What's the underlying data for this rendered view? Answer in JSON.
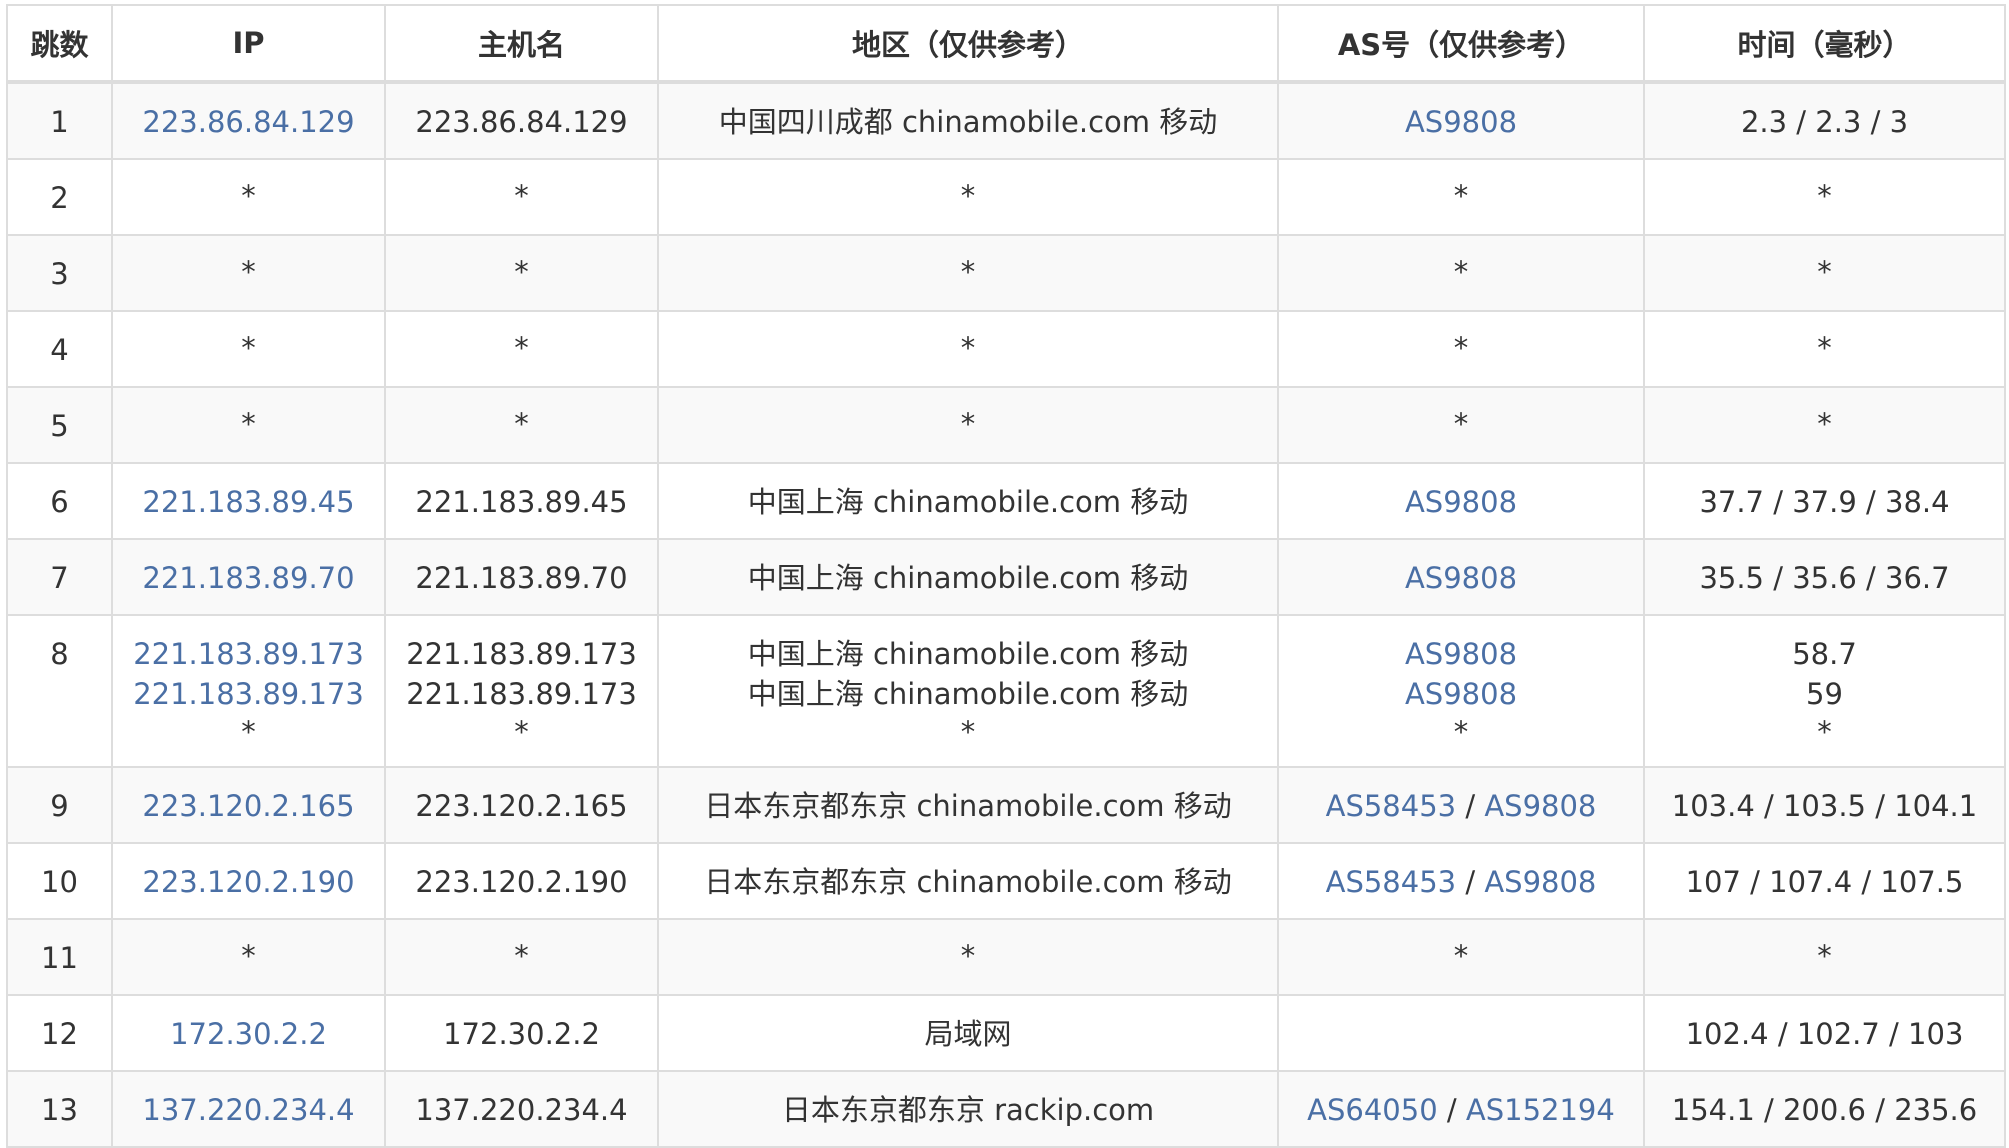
{
  "headers": {
    "hop": "跳数",
    "ip": "IP",
    "host": "主机名",
    "region": "地区（仅供参考）",
    "as": "AS号（仅供参考）",
    "time": "时间（毫秒）"
  },
  "sep": "/",
  "rows": [
    {
      "hop": "1",
      "ip": [
        "223.86.84.129"
      ],
      "host": [
        "223.86.84.129"
      ],
      "region": [
        "中国四川成都 chinamobile.com 移动"
      ],
      "as": [
        [
          "AS9808"
        ]
      ],
      "time": [
        "2.3 / 2.3 / 3"
      ]
    },
    {
      "hop": "2",
      "ip": [
        "*"
      ],
      "host": [
        "*"
      ],
      "region": [
        "*"
      ],
      "as": [
        [
          "*"
        ]
      ],
      "time": [
        "*"
      ]
    },
    {
      "hop": "3",
      "ip": [
        "*"
      ],
      "host": [
        "*"
      ],
      "region": [
        "*"
      ],
      "as": [
        [
          "*"
        ]
      ],
      "time": [
        "*"
      ]
    },
    {
      "hop": "4",
      "ip": [
        "*"
      ],
      "host": [
        "*"
      ],
      "region": [
        "*"
      ],
      "as": [
        [
          "*"
        ]
      ],
      "time": [
        "*"
      ]
    },
    {
      "hop": "5",
      "ip": [
        "*"
      ],
      "host": [
        "*"
      ],
      "region": [
        "*"
      ],
      "as": [
        [
          "*"
        ]
      ],
      "time": [
        "*"
      ]
    },
    {
      "hop": "6",
      "ip": [
        "221.183.89.45"
      ],
      "host": [
        "221.183.89.45"
      ],
      "region": [
        "中国上海 chinamobile.com 移动"
      ],
      "as": [
        [
          "AS9808"
        ]
      ],
      "time": [
        "37.7 / 37.9 / 38.4"
      ]
    },
    {
      "hop": "7",
      "ip": [
        "221.183.89.70"
      ],
      "host": [
        "221.183.89.70"
      ],
      "region": [
        "中国上海 chinamobile.com 移动"
      ],
      "as": [
        [
          "AS9808"
        ]
      ],
      "time": [
        "35.5 / 35.6 / 36.7"
      ]
    },
    {
      "hop": "8",
      "ip": [
        "221.183.89.173",
        "221.183.89.173",
        "*"
      ],
      "host": [
        "221.183.89.173",
        "221.183.89.173",
        "*"
      ],
      "region": [
        "中国上海 chinamobile.com 移动",
        "中国上海 chinamobile.com 移动",
        "*"
      ],
      "as": [
        [
          "AS9808"
        ],
        [
          "AS9808"
        ],
        [
          "*"
        ]
      ],
      "time": [
        "58.7",
        "59",
        "*"
      ]
    },
    {
      "hop": "9",
      "ip": [
        "223.120.2.165"
      ],
      "host": [
        "223.120.2.165"
      ],
      "region": [
        "日本东京都东京 chinamobile.com 移动"
      ],
      "as": [
        [
          "AS58453",
          "AS9808"
        ]
      ],
      "time": [
        "103.4 / 103.5 / 104.1"
      ]
    },
    {
      "hop": "10",
      "ip": [
        "223.120.2.190"
      ],
      "host": [
        "223.120.2.190"
      ],
      "region": [
        "日本东京都东京 chinamobile.com 移动"
      ],
      "as": [
        [
          "AS58453",
          "AS9808"
        ]
      ],
      "time": [
        "107 / 107.4 / 107.5"
      ]
    },
    {
      "hop": "11",
      "ip": [
        "*"
      ],
      "host": [
        "*"
      ],
      "region": [
        "*"
      ],
      "as": [
        [
          "*"
        ]
      ],
      "time": [
        "*"
      ]
    },
    {
      "hop": "12",
      "ip": [
        "172.30.2.2"
      ],
      "host": [
        "172.30.2.2"
      ],
      "region": [
        "局域网"
      ],
      "as": [
        []
      ],
      "time": [
        "102.4 / 102.7 / 103"
      ]
    },
    {
      "hop": "13",
      "ip": [
        "137.220.234.4"
      ],
      "host": [
        "137.220.234.4"
      ],
      "region": [
        "日本东京都东京 rackip.com"
      ],
      "as": [
        [
          "AS64050",
          "AS152194"
        ]
      ],
      "time": [
        "154.1 / 200.6 / 235.6"
      ]
    }
  ],
  "colors": {
    "link": "#4a6fa5",
    "text": "#333333",
    "border": "#dddddd",
    "stripe": "#f9f9f9"
  }
}
